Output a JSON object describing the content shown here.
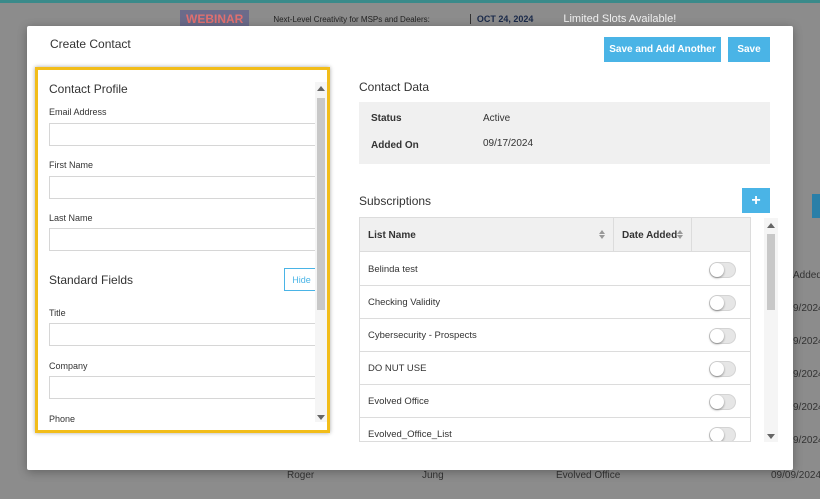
{
  "background": {
    "banner": {
      "webinar": "WEBINAR",
      "description": "Next-Level Creativity for MSPs and Dealers:",
      "date": "OCT 24, 2024",
      "slots": "Limited Slots Available!"
    },
    "column_header_added": "Added",
    "row_dates": [
      "9/2024",
      "9/2024",
      "9/2024",
      "9/2024",
      "9/2024"
    ],
    "last_row": {
      "first": "Roger",
      "last": "Jung",
      "company": "Evolved Office",
      "date": "09/09/2024"
    }
  },
  "modal": {
    "title": "Create Contact",
    "save_and_add_label": "Save and Add Another",
    "save_label": "Save"
  },
  "profile": {
    "section_title": "Contact Profile",
    "email_label": "Email Address",
    "first_name_label": "First Name",
    "last_name_label": "Last Name",
    "standard_fields_title": "Standard Fields",
    "hide_label": "Hide",
    "title_label": "Title",
    "company_label": "Company",
    "phone_label": "Phone"
  },
  "contact_data": {
    "title": "Contact Data",
    "status_label": "Status",
    "status_value": "Active",
    "added_on_label": "Added On",
    "added_on_value": "09/17/2024"
  },
  "subscriptions": {
    "title": "Subscriptions",
    "add_label": "+",
    "col_list_name": "List Name",
    "col_date_added": "Date Added",
    "rows": [
      {
        "name": "Belinda test"
      },
      {
        "name": "Checking Validity"
      },
      {
        "name": "Cybersecurity - Prospects"
      },
      {
        "name": "DO NUT USE"
      },
      {
        "name": "Evolved Office"
      },
      {
        "name": "Evolved_Office_List"
      }
    ]
  },
  "colors": {
    "accent": "#4ab4e6",
    "highlight_border": "#f2bd1a"
  }
}
